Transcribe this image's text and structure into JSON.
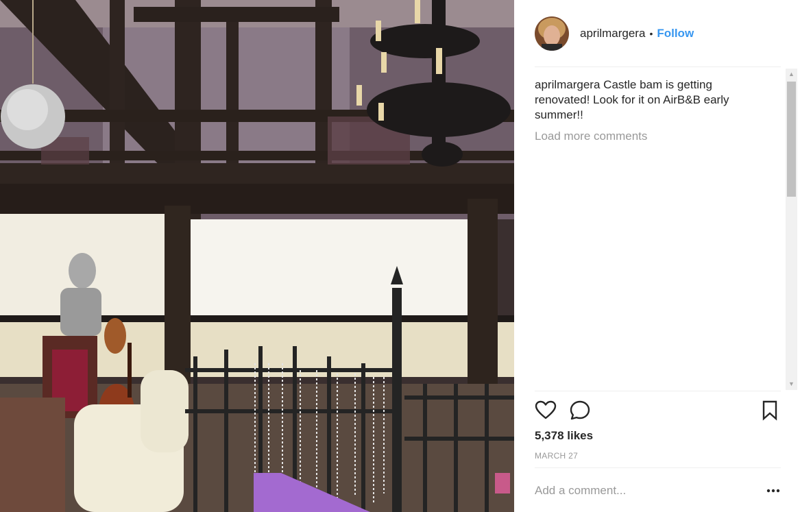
{
  "post": {
    "photo_alt": "",
    "header": {
      "username": "aprilmargera",
      "separator": "•",
      "follow_label": "Follow"
    },
    "caption": {
      "username": "aprilmargera",
      "text": "Castle bam is getting renovated! Look for it on AirB&B early summer!!"
    },
    "load_more_label": "Load more comments",
    "likes_label": "5,378 likes",
    "date_label": "MARCH 27",
    "comment_input": {
      "placeholder": "Add a comment...",
      "value": ""
    },
    "icons": {
      "like": "heart-icon",
      "comment": "comment-bubble-icon",
      "save": "bookmark-icon",
      "more": "more-options-icon"
    },
    "colors": {
      "link": "#3897f0",
      "muted": "#999999",
      "text": "#262626",
      "divider": "#efefef"
    }
  }
}
